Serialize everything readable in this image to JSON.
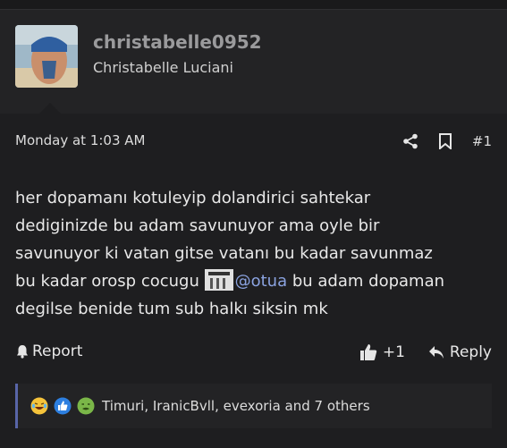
{
  "author": {
    "username": "christabelle0952",
    "real_name": "Christabelle Luciani"
  },
  "post": {
    "date": "Monday at 1:03 AM",
    "number": "#1",
    "line1": "her dopamanı kotuleyip dolandirici sahtekar",
    "line2": "dediginizde bu adam savunuyor ama oyle bir",
    "line3": "savunuyor ki vatan gitse vatanı bu kadar savunmaz",
    "line4_pre": "bu kadar orosp cocugu ",
    "mention": "@otua",
    "line4_post": " bu adam dopaman",
    "line5": "degilse benide tum sub halkı siksin mk"
  },
  "actions": {
    "report": "Report",
    "like_count": "+1",
    "reply": "Reply"
  },
  "reactions": {
    "text": "Timuri, IranicBvll, evexoria and 7 others",
    "icons": [
      "laughing-emoji",
      "thumbs-up-emoji",
      "sick-emoji"
    ]
  },
  "colors": {
    "accent": "#5865a8",
    "mention": "#8ba3e0"
  }
}
